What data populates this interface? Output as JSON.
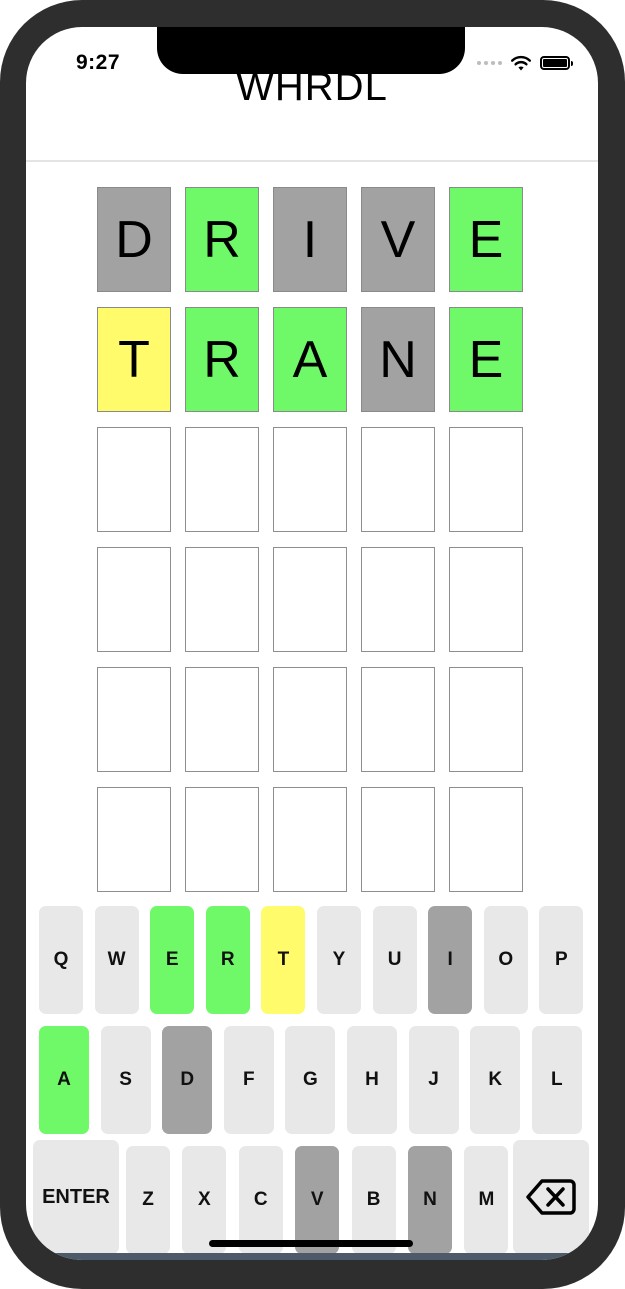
{
  "status_bar": {
    "time": "9:27"
  },
  "app": {
    "title": "WHRDL"
  },
  "board": {
    "rows": [
      [
        {
          "letter": "D",
          "state": "absent"
        },
        {
          "letter": "R",
          "state": "correct"
        },
        {
          "letter": "I",
          "state": "absent"
        },
        {
          "letter": "V",
          "state": "absent"
        },
        {
          "letter": "E",
          "state": "correct"
        }
      ],
      [
        {
          "letter": "T",
          "state": "present"
        },
        {
          "letter": "R",
          "state": "correct"
        },
        {
          "letter": "A",
          "state": "correct"
        },
        {
          "letter": "N",
          "state": "absent"
        },
        {
          "letter": "E",
          "state": "correct"
        }
      ],
      [
        {
          "letter": "",
          "state": "empty"
        },
        {
          "letter": "",
          "state": "empty"
        },
        {
          "letter": "",
          "state": "empty"
        },
        {
          "letter": "",
          "state": "empty"
        },
        {
          "letter": "",
          "state": "empty"
        }
      ],
      [
        {
          "letter": "",
          "state": "empty"
        },
        {
          "letter": "",
          "state": "empty"
        },
        {
          "letter": "",
          "state": "empty"
        },
        {
          "letter": "",
          "state": "empty"
        },
        {
          "letter": "",
          "state": "empty"
        }
      ],
      [
        {
          "letter": "",
          "state": "empty"
        },
        {
          "letter": "",
          "state": "empty"
        },
        {
          "letter": "",
          "state": "empty"
        },
        {
          "letter": "",
          "state": "empty"
        },
        {
          "letter": "",
          "state": "empty"
        }
      ],
      [
        {
          "letter": "",
          "state": "empty"
        },
        {
          "letter": "",
          "state": "empty"
        },
        {
          "letter": "",
          "state": "empty"
        },
        {
          "letter": "",
          "state": "empty"
        },
        {
          "letter": "",
          "state": "empty"
        }
      ]
    ]
  },
  "keyboard": {
    "row1": [
      {
        "label": "Q",
        "state": "unused"
      },
      {
        "label": "W",
        "state": "unused"
      },
      {
        "label": "E",
        "state": "correct"
      },
      {
        "label": "R",
        "state": "correct"
      },
      {
        "label": "T",
        "state": "present"
      },
      {
        "label": "Y",
        "state": "unused"
      },
      {
        "label": "U",
        "state": "unused"
      },
      {
        "label": "I",
        "state": "absent"
      },
      {
        "label": "O",
        "state": "unused"
      },
      {
        "label": "P",
        "state": "unused"
      }
    ],
    "row2": [
      {
        "label": "A",
        "state": "correct"
      },
      {
        "label": "S",
        "state": "unused"
      },
      {
        "label": "D",
        "state": "absent"
      },
      {
        "label": "F",
        "state": "unused"
      },
      {
        "label": "G",
        "state": "unused"
      },
      {
        "label": "H",
        "state": "unused"
      },
      {
        "label": "J",
        "state": "unused"
      },
      {
        "label": "K",
        "state": "unused"
      },
      {
        "label": "L",
        "state": "unused"
      }
    ],
    "row3": [
      {
        "label": "Z",
        "state": "unused"
      },
      {
        "label": "X",
        "state": "unused"
      },
      {
        "label": "C",
        "state": "unused"
      },
      {
        "label": "V",
        "state": "absent"
      },
      {
        "label": "B",
        "state": "unused"
      },
      {
        "label": "N",
        "state": "absent"
      },
      {
        "label": "M",
        "state": "unused"
      }
    ],
    "enter_label": "ENTER",
    "backspace_icon": "backspace-icon"
  },
  "colors": {
    "correct": "#6ff868",
    "present": "#fffb6a",
    "absent": "#a2a2a2",
    "key_default": "#e8e8e8"
  }
}
